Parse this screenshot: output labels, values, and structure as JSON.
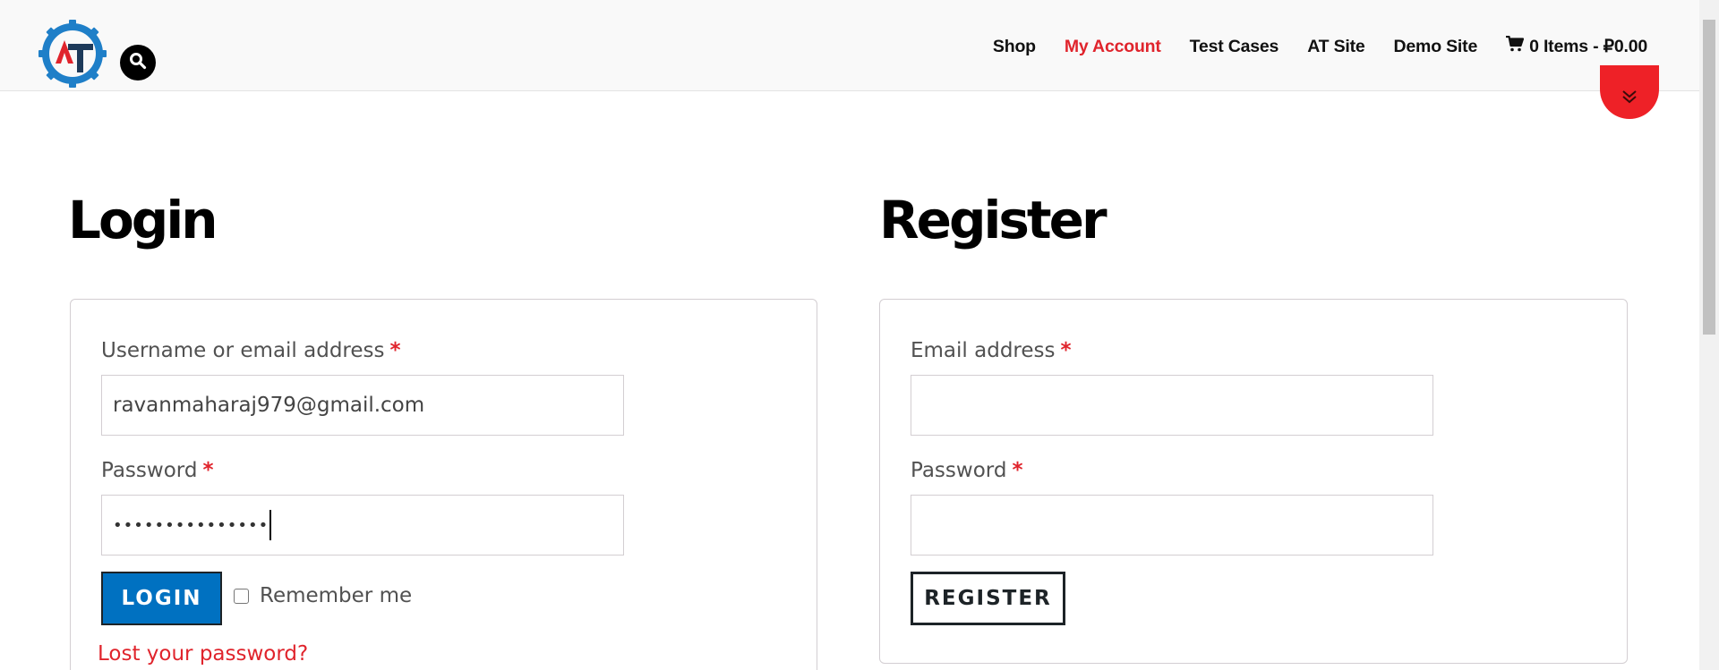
{
  "header": {
    "logo_text": "AT",
    "nav": [
      {
        "label": "Shop"
      },
      {
        "label": "My Account",
        "active": true
      },
      {
        "label": "Test Cases"
      },
      {
        "label": "AT Site"
      },
      {
        "label": "Demo Site"
      }
    ],
    "cart": {
      "label": "0 Items - ₽0.00",
      "icon": "cart-icon"
    }
  },
  "login": {
    "title": "Login",
    "username_label": "Username or email address",
    "username_value": "ravanmaharaj979@gmail.com",
    "password_label": "Password",
    "password_value": "•••••••••••••••",
    "required_mark": "*",
    "login_button": "LOGIN",
    "remember_label": "Remember me",
    "lost_password": "Lost your password?"
  },
  "register": {
    "title": "Register",
    "email_label": "Email address",
    "email_value": "",
    "password_label": "Password",
    "password_value": "",
    "required_mark": "*",
    "register_button": "REGISTER"
  },
  "colors": {
    "accent_red": "#e0242c",
    "login_blue": "#0071c1"
  }
}
